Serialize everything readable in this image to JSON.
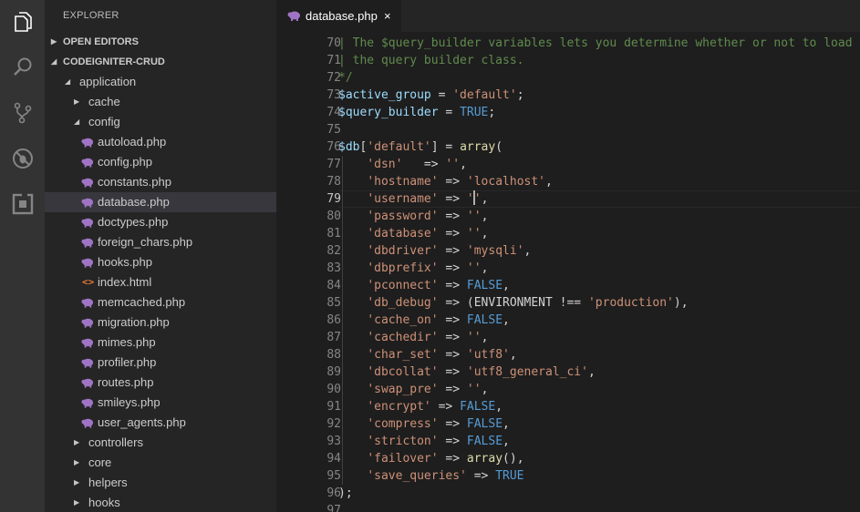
{
  "colors": {
    "accent": "#007acc",
    "php_icon": "#a074c4",
    "html_icon": "#e37933"
  },
  "activity_bar": {
    "icons": [
      "files-icon",
      "search-icon",
      "source-control-icon",
      "debug-icon",
      "extensions-icon"
    ]
  },
  "explorer": {
    "title": "EXPLORER",
    "sections": {
      "open_editors": "OPEN EDITORS",
      "project": "CODEIGNITER-CRUD"
    },
    "tree": [
      {
        "label": "application",
        "kind": "folder",
        "open": true,
        "depth": 1
      },
      {
        "label": "cache",
        "kind": "folder",
        "open": false,
        "depth": 2
      },
      {
        "label": "config",
        "kind": "folder",
        "open": true,
        "depth": 2
      },
      {
        "label": "autoload.php",
        "kind": "php",
        "depth": 3
      },
      {
        "label": "config.php",
        "kind": "php",
        "depth": 3
      },
      {
        "label": "constants.php",
        "kind": "php",
        "depth": 3
      },
      {
        "label": "database.php",
        "kind": "php",
        "depth": 3,
        "selected": true
      },
      {
        "label": "doctypes.php",
        "kind": "php",
        "depth": 3
      },
      {
        "label": "foreign_chars.php",
        "kind": "php",
        "depth": 3
      },
      {
        "label": "hooks.php",
        "kind": "php",
        "depth": 3
      },
      {
        "label": "index.html",
        "kind": "html",
        "depth": 3
      },
      {
        "label": "memcached.php",
        "kind": "php",
        "depth": 3
      },
      {
        "label": "migration.php",
        "kind": "php",
        "depth": 3
      },
      {
        "label": "mimes.php",
        "kind": "php",
        "depth": 3
      },
      {
        "label": "profiler.php",
        "kind": "php",
        "depth": 3
      },
      {
        "label": "routes.php",
        "kind": "php",
        "depth": 3
      },
      {
        "label": "smileys.php",
        "kind": "php",
        "depth": 3
      },
      {
        "label": "user_agents.php",
        "kind": "php",
        "depth": 3
      },
      {
        "label": "controllers",
        "kind": "folder",
        "open": false,
        "depth": 2
      },
      {
        "label": "core",
        "kind": "folder",
        "open": false,
        "depth": 2
      },
      {
        "label": "helpers",
        "kind": "folder",
        "open": false,
        "depth": 2
      },
      {
        "label": "hooks",
        "kind": "folder",
        "open": false,
        "depth": 2
      }
    ]
  },
  "tab": {
    "label": "database.php",
    "close": "×"
  },
  "editor": {
    "current_line": 79,
    "lines": [
      {
        "n": "70",
        "tokens": [
          [
            "c",
            "| The $query_builder variables lets you determine whether or not to load"
          ]
        ]
      },
      {
        "n": "71",
        "tokens": [
          [
            "c",
            "| the query builder class."
          ]
        ]
      },
      {
        "n": "72",
        "tokens": [
          [
            "c",
            "*/"
          ]
        ]
      },
      {
        "n": "73",
        "tokens": [
          [
            "v",
            "$active_group"
          ],
          [
            "o",
            " = "
          ],
          [
            "s",
            "'default'"
          ],
          [
            "o",
            ";"
          ]
        ]
      },
      {
        "n": "74",
        "tokens": [
          [
            "v",
            "$query_builder"
          ],
          [
            "o",
            " = "
          ],
          [
            "k",
            "TRUE"
          ],
          [
            "o",
            ";"
          ]
        ]
      },
      {
        "n": "75",
        "tokens": []
      },
      {
        "n": "76",
        "tokens": [
          [
            "v",
            "$db"
          ],
          [
            "o",
            "["
          ],
          [
            "s",
            "'default'"
          ],
          [
            "o",
            "] = "
          ],
          [
            "f",
            "array"
          ],
          [
            "o",
            "("
          ]
        ]
      },
      {
        "n": "77",
        "guide": true,
        "tokens": [
          [
            "o",
            "    "
          ],
          [
            "s",
            "'dsn'"
          ],
          [
            "o",
            "   => "
          ],
          [
            "s",
            "''"
          ],
          [
            "o",
            ","
          ]
        ]
      },
      {
        "n": "78",
        "guide": true,
        "tokens": [
          [
            "o",
            "    "
          ],
          [
            "s",
            "'hostname'"
          ],
          [
            "o",
            " => "
          ],
          [
            "s",
            "'localhost'"
          ],
          [
            "o",
            ","
          ]
        ]
      },
      {
        "n": "79",
        "guide": true,
        "tokens": [
          [
            "o",
            "    "
          ],
          [
            "s",
            "'username'"
          ],
          [
            "o",
            " => "
          ],
          [
            "s",
            "'"
          ],
          [
            "caret",
            ""
          ],
          [
            "s",
            "'"
          ],
          [
            "o",
            ","
          ]
        ]
      },
      {
        "n": "80",
        "guide": true,
        "tokens": [
          [
            "o",
            "    "
          ],
          [
            "s",
            "'password'"
          ],
          [
            "o",
            " => "
          ],
          [
            "s",
            "''"
          ],
          [
            "o",
            ","
          ]
        ]
      },
      {
        "n": "81",
        "guide": true,
        "tokens": [
          [
            "o",
            "    "
          ],
          [
            "s",
            "'database'"
          ],
          [
            "o",
            " => "
          ],
          [
            "s",
            "''"
          ],
          [
            "o",
            ","
          ]
        ]
      },
      {
        "n": "82",
        "guide": true,
        "tokens": [
          [
            "o",
            "    "
          ],
          [
            "s",
            "'dbdriver'"
          ],
          [
            "o",
            " => "
          ],
          [
            "s",
            "'mysqli'"
          ],
          [
            "o",
            ","
          ]
        ]
      },
      {
        "n": "83",
        "guide": true,
        "tokens": [
          [
            "o",
            "    "
          ],
          [
            "s",
            "'dbprefix'"
          ],
          [
            "o",
            " => "
          ],
          [
            "s",
            "''"
          ],
          [
            "o",
            ","
          ]
        ]
      },
      {
        "n": "84",
        "guide": true,
        "tokens": [
          [
            "o",
            "    "
          ],
          [
            "s",
            "'pconnect'"
          ],
          [
            "o",
            " => "
          ],
          [
            "k",
            "FALSE"
          ],
          [
            "o",
            ","
          ]
        ]
      },
      {
        "n": "85",
        "guide": true,
        "tokens": [
          [
            "o",
            "    "
          ],
          [
            "s",
            "'db_debug'"
          ],
          [
            "o",
            " => (ENVIRONMENT !== "
          ],
          [
            "s",
            "'production'"
          ],
          [
            "o",
            "),"
          ]
        ]
      },
      {
        "n": "86",
        "guide": true,
        "tokens": [
          [
            "o",
            "    "
          ],
          [
            "s",
            "'cache_on'"
          ],
          [
            "o",
            " => "
          ],
          [
            "k",
            "FALSE"
          ],
          [
            "o",
            ","
          ]
        ]
      },
      {
        "n": "87",
        "guide": true,
        "tokens": [
          [
            "o",
            "    "
          ],
          [
            "s",
            "'cachedir'"
          ],
          [
            "o",
            " => "
          ],
          [
            "s",
            "''"
          ],
          [
            "o",
            ","
          ]
        ]
      },
      {
        "n": "88",
        "guide": true,
        "tokens": [
          [
            "o",
            "    "
          ],
          [
            "s",
            "'char_set'"
          ],
          [
            "o",
            " => "
          ],
          [
            "s",
            "'utf8'"
          ],
          [
            "o",
            ","
          ]
        ]
      },
      {
        "n": "89",
        "guide": true,
        "tokens": [
          [
            "o",
            "    "
          ],
          [
            "s",
            "'dbcollat'"
          ],
          [
            "o",
            " => "
          ],
          [
            "s",
            "'utf8_general_ci'"
          ],
          [
            "o",
            ","
          ]
        ]
      },
      {
        "n": "90",
        "guide": true,
        "tokens": [
          [
            "o",
            "    "
          ],
          [
            "s",
            "'swap_pre'"
          ],
          [
            "o",
            " => "
          ],
          [
            "s",
            "''"
          ],
          [
            "o",
            ","
          ]
        ]
      },
      {
        "n": "91",
        "guide": true,
        "tokens": [
          [
            "o",
            "    "
          ],
          [
            "s",
            "'encrypt'"
          ],
          [
            "o",
            " => "
          ],
          [
            "k",
            "FALSE"
          ],
          [
            "o",
            ","
          ]
        ]
      },
      {
        "n": "92",
        "guide": true,
        "tokens": [
          [
            "o",
            "    "
          ],
          [
            "s",
            "'compress'"
          ],
          [
            "o",
            " => "
          ],
          [
            "k",
            "FALSE"
          ],
          [
            "o",
            ","
          ]
        ]
      },
      {
        "n": "93",
        "guide": true,
        "tokens": [
          [
            "o",
            "    "
          ],
          [
            "s",
            "'stricton'"
          ],
          [
            "o",
            " => "
          ],
          [
            "k",
            "FALSE"
          ],
          [
            "o",
            ","
          ]
        ]
      },
      {
        "n": "94",
        "guide": true,
        "tokens": [
          [
            "o",
            "    "
          ],
          [
            "s",
            "'failover'"
          ],
          [
            "o",
            " => "
          ],
          [
            "f",
            "array"
          ],
          [
            "o",
            "(),"
          ]
        ]
      },
      {
        "n": "95",
        "guide": true,
        "tokens": [
          [
            "o",
            "    "
          ],
          [
            "s",
            "'save_queries'"
          ],
          [
            "o",
            " => "
          ],
          [
            "k",
            "TRUE"
          ]
        ]
      },
      {
        "n": "96",
        "tokens": [
          [
            "o",
            ");"
          ]
        ]
      },
      {
        "n": "97",
        "tokens": []
      }
    ]
  }
}
